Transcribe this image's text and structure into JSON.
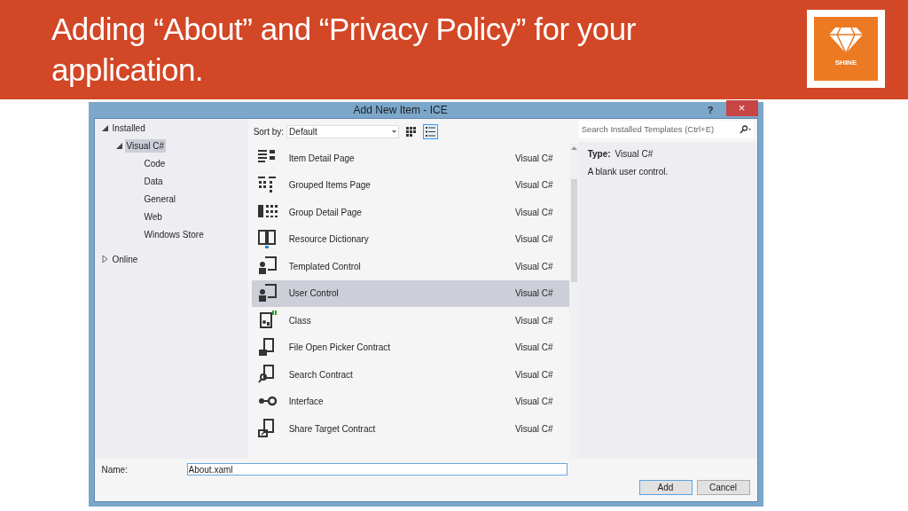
{
  "slide": {
    "title": "Adding “About” and “Privacy Policy” for your application.",
    "logo_text": "SHINE"
  },
  "dialog": {
    "title": "Add New Item - ICE",
    "help": "?",
    "close": "×",
    "tree": [
      {
        "label": "Installed",
        "expanded": true,
        "selected": false,
        "children": [
          {
            "label": "Visual C#",
            "expanded": true,
            "selected": true,
            "children": [
              {
                "label": "Code",
                "selected": false
              },
              {
                "label": "Data",
                "selected": false
              },
              {
                "label": "General",
                "selected": false
              },
              {
                "label": "Web",
                "selected": false
              },
              {
                "label": "Windows Store",
                "selected": false
              }
            ]
          }
        ]
      },
      {
        "label": "Online",
        "expanded": false,
        "selected": false
      }
    ],
    "sort_label": "Sort by:",
    "sort_value": "Default",
    "view_modes": [
      {
        "kind": "grid",
        "selected": false
      },
      {
        "kind": "list",
        "selected": true
      }
    ],
    "search": {
      "placeholder": "Search Installed Templates (Ctrl+E)"
    },
    "items": [
      {
        "name": "Item Detail Page",
        "type": "Visual C#",
        "selected": false
      },
      {
        "name": "Grouped Items Page",
        "type": "Visual C#",
        "selected": false
      },
      {
        "name": "Group Detail Page",
        "type": "Visual C#",
        "selected": false
      },
      {
        "name": "Resource Dictionary",
        "type": "Visual C#",
        "selected": false
      },
      {
        "name": "Templated Control",
        "type": "Visual C#",
        "selected": false
      },
      {
        "name": "User Control",
        "type": "Visual C#",
        "selected": true
      },
      {
        "name": "Class",
        "type": "Visual C#",
        "selected": false
      },
      {
        "name": "File Open Picker Contract",
        "type": "Visual C#",
        "selected": false
      },
      {
        "name": "Search Contract",
        "type": "Visual C#",
        "selected": false
      },
      {
        "name": "Interface",
        "type": "Visual C#",
        "selected": false
      },
      {
        "name": "Share Target Contract",
        "type": "Visual C#",
        "selected": false
      }
    ],
    "details": {
      "type_label": "Type:",
      "type_value": "Visual C#",
      "description": "A blank user control."
    },
    "name_label": "Name:",
    "name_value": "About.xaml",
    "buttons": [
      {
        "label": "Add",
        "kind": "default"
      },
      {
        "label": "Cancel",
        "kind": "normal"
      }
    ]
  }
}
